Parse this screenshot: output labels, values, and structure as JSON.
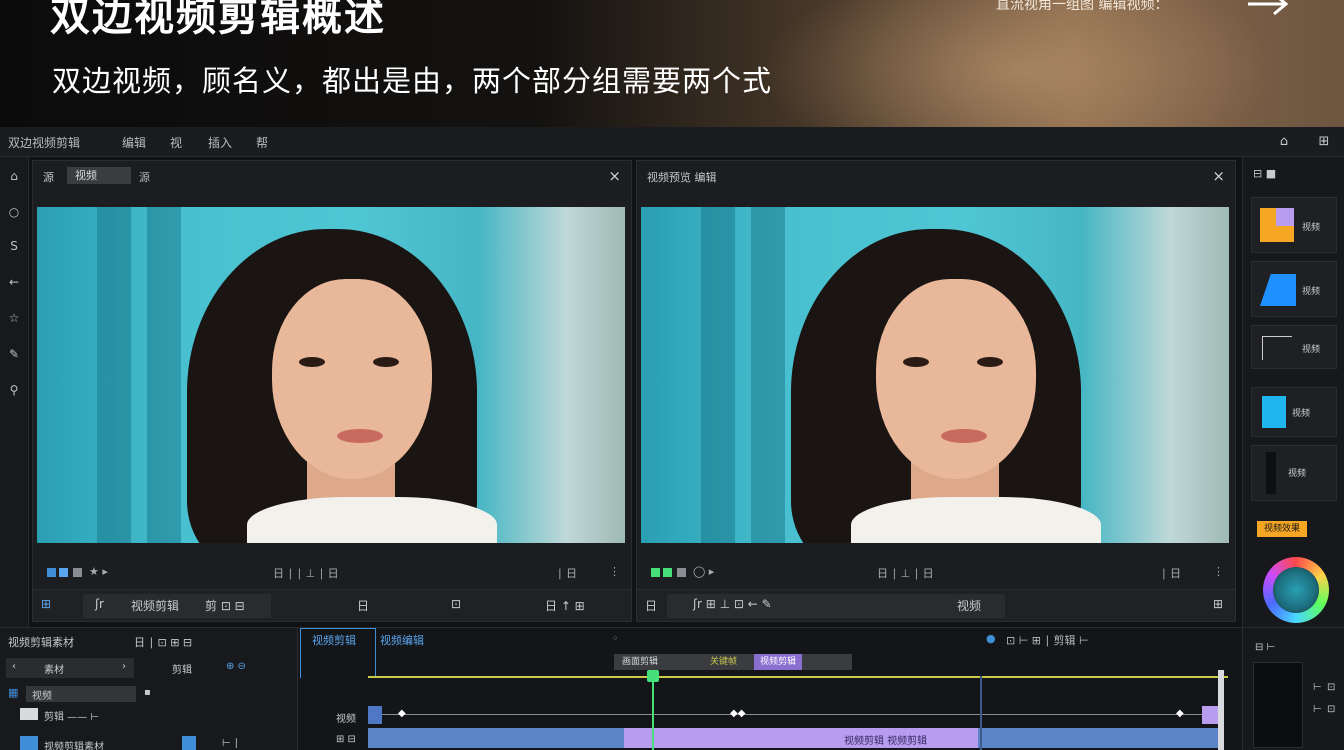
{
  "banner": {
    "title": "双边视频剪辑概述",
    "subtitle": "双边视频，顾名义，都出是由，两个部分组需要两个式",
    "link_text": "直流视角一组图 编辑视频："
  },
  "menu": {
    "items": [
      "双边视频剪辑",
      "编辑",
      "视",
      "插入",
      "帮"
    ],
    "right_buttons": [
      "⌂",
      "⊞"
    ]
  },
  "left_tools": [
    "⌂",
    "○",
    "S",
    "←",
    "☆",
    "✎",
    "⚲"
  ],
  "viewers": [
    {
      "title": "源",
      "tab": "视频",
      "tab2": "源",
      "close": "×",
      "ctrl_left": "★ ▸",
      "ctrl_mid": "日 ∣ ∣ ⊥ ∣ 日",
      "ctrl_right": "∣ 日",
      "tools": {
        "a": "ʃr",
        "b": "视频剪辑",
        "c": "剪 ⊡ ⊟",
        "d": "日",
        "e": "⊡",
        "f": "日 ↑ ⊞"
      }
    },
    {
      "title": "视频预览 编辑",
      "close": "×",
      "ctrl_left": "◯ ▸",
      "ctrl_mid": "日 ∣ ⊥ ∣ 日",
      "ctrl_right": "∣ 日",
      "tools": {
        "a": "日",
        "b": "ʃr  ⊞  ⊥  ⊡  ←  ✎",
        "c": "视频",
        "d": "⊞"
      }
    }
  ],
  "right_panel": {
    "head": "⊟ ■",
    "cards": [
      {
        "label": "视频"
      },
      {
        "label": "视频"
      },
      {
        "label": "视频"
      },
      {
        "label": "视频"
      },
      {
        "label": "视频"
      }
    ],
    "orange_button": "视频效果"
  },
  "library": {
    "title": "视频剪辑素材",
    "tools": "日 ∣ ⊡ ⊞ ⊟",
    "search": "素材",
    "label1": "剪辑",
    "label2": "⊕ ⊖",
    "row1": "视频",
    "row2": "剪辑  ——  ⊢",
    "row3": "视频剪辑素材",
    "row3b": "⊢ ∣"
  },
  "timeline": {
    "tab1": "视频剪辑",
    "tab2": "视频编辑",
    "tools_right": "⊡ ⊢  ⊞ ∣ 剪辑 ⊢",
    "tag1": "画面剪辑",
    "tag2": "关键帧",
    "tag3": "视频剪辑",
    "track1_label": "视频",
    "track2_label": "⊞ ⊟",
    "clip_label": "视频剪辑 视频剪辑"
  },
  "colors": {
    "accent_blue": "#3e8ed8",
    "clip_purple": "#b79cf0",
    "clip_blue": "#5a86c8",
    "playhead_green": "#45e07a",
    "orange": "#f5a623"
  }
}
